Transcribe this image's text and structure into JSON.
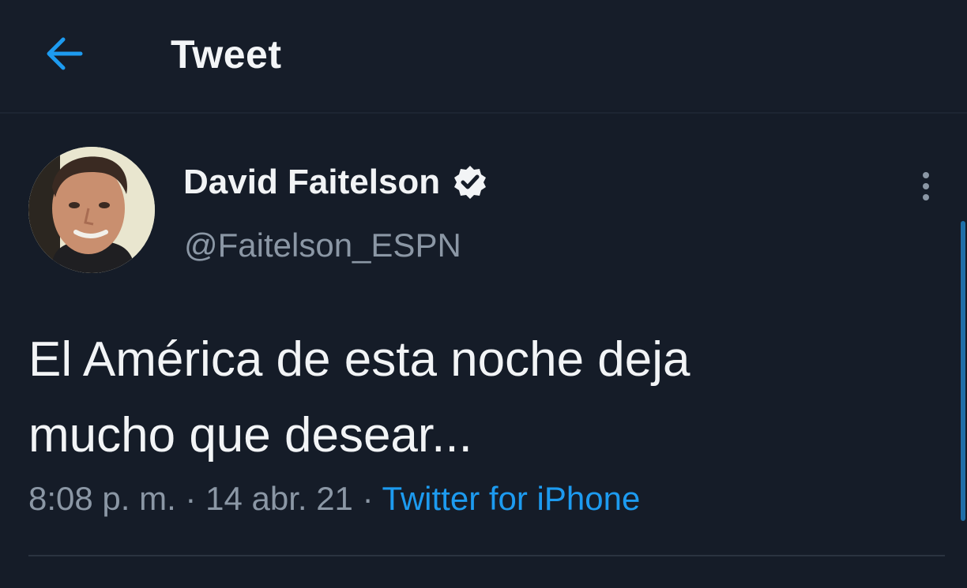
{
  "header": {
    "back_icon": "arrow-left-icon",
    "title": "Tweet"
  },
  "tweet": {
    "author": {
      "display_name": "David Faitelson",
      "verified_icon": "verified-badge-icon",
      "handle": "@Faitelson_ESPN"
    },
    "more_icon": "more-vertical-icon",
    "text": "El América de esta noche deja\nmucho que desear...",
    "time": "8:08 p. m.",
    "separator": " · ",
    "date": "14 abr. 21",
    "source": "Twitter for iPhone"
  },
  "colors": {
    "background": "#151c28",
    "accent": "#1d9bf0",
    "secondary_text": "#8b97a5"
  }
}
